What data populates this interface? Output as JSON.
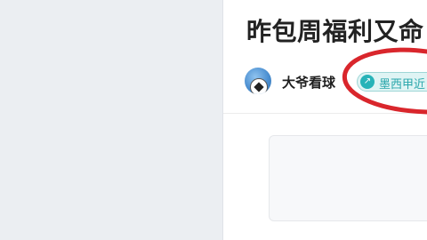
{
  "article": {
    "title": "昨包周福利又命",
    "author": {
      "name": "大爷看球"
    },
    "tag": {
      "label": "墨西甲近",
      "icon": "arrow-icon"
    }
  },
  "colors": {
    "left_pane": "#ebeef2",
    "article_bg": "#ffffff",
    "tag_teal": "#27b3b8",
    "annotation_red": "#d9262c"
  }
}
